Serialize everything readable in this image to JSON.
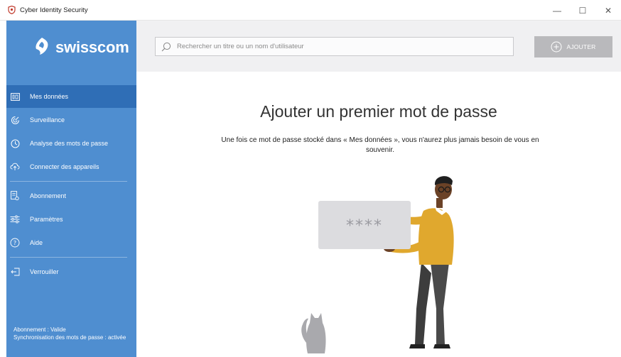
{
  "window": {
    "title": "Cyber Identity Security",
    "controls": {
      "minimize": "—",
      "maximize": "☐",
      "close": "✕"
    }
  },
  "brand": {
    "name": "swisscom"
  },
  "sidebar": {
    "items": [
      {
        "label": "Mes données",
        "icon": "data-icon",
        "active": true
      },
      {
        "label": "Surveillance",
        "icon": "surveillance-icon"
      },
      {
        "label": "Analyse des mots de passe",
        "icon": "analysis-icon"
      },
      {
        "label": "Connecter des appareils",
        "icon": "connect-devices-icon"
      },
      {
        "label": "Abonnement",
        "icon": "subscription-icon"
      },
      {
        "label": "Paramètres",
        "icon": "settings-sliders-icon"
      },
      {
        "label": "Aide",
        "icon": "help-icon"
      },
      {
        "label": "Verrouiller",
        "icon": "lock-exit-icon"
      }
    ],
    "footer": {
      "subscription": "Abonnement : Valide",
      "sync": "Synchronisation des mots de passe : activée"
    }
  },
  "search": {
    "placeholder": "Rechercher un titre ou un nom d'utilisateur"
  },
  "toolbar": {
    "add_label": "AJOUTER"
  },
  "main": {
    "title": "Ajouter un premier mot de passe",
    "description": "Une fois ce mot de passe stocké dans « Mes données », vous n'aurez plus jamais besoin de vous en souvenir.",
    "card_text": "****"
  },
  "colors": {
    "sidebar": "#4f8ed0",
    "sidebar_active": "#2f6eb6",
    "topbar": "#f0f0f2",
    "button": "#b9b9bc",
    "sweater": "#e0a82e"
  }
}
